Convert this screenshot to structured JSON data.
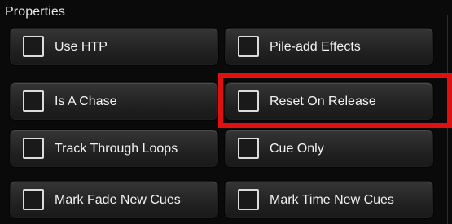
{
  "group": {
    "title": "Properties"
  },
  "options": [
    {
      "label": "Use HTP",
      "checked": false
    },
    {
      "label": "Pile-add Effects",
      "checked": false
    },
    {
      "label": "Is A Chase",
      "checked": false
    },
    {
      "label": "Reset On Release",
      "checked": false
    },
    {
      "label": "Track Through Loops",
      "checked": false
    },
    {
      "label": "Cue Only",
      "checked": false
    },
    {
      "label": "Mark Fade New Cues",
      "checked": false
    },
    {
      "label": "Mark Time New Cues",
      "checked": false
    }
  ],
  "highlight": {
    "color": "#e01010",
    "target": "Reset On Release"
  }
}
